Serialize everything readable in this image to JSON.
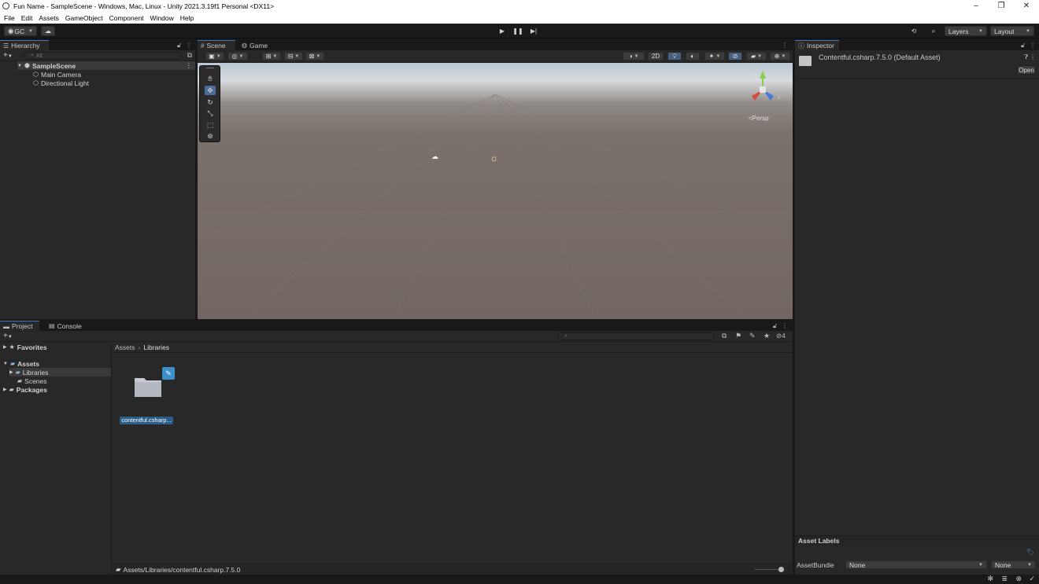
{
  "window": {
    "title": "Fun Name - SampleScene - Windows, Mac, Linux - Unity 2021.3.19f1 Personal <DX11>",
    "controls": {
      "minimize": "–",
      "maximize": "❐",
      "close": "✕"
    }
  },
  "menu": [
    "File",
    "Edit",
    "Assets",
    "GameObject",
    "Component",
    "Window",
    "Help"
  ],
  "toolbar": {
    "account_label": "GC",
    "layers_label": "Layers",
    "layout_label": "Layout"
  },
  "hierarchy": {
    "tab_label": "Hierarchy",
    "search_placeholder": "All",
    "scene_name": "SampleScene",
    "objects": [
      "Main Camera",
      "Directional Light"
    ]
  },
  "scene": {
    "tabs": [
      "Scene",
      "Game"
    ],
    "toggle_2d": "2D",
    "projection_label": "Persp",
    "gizmo_axes": {
      "y": "y",
      "z": "z"
    }
  },
  "inspector": {
    "tab_label": "Inspector",
    "asset_title": "Contentful.csharp.7.5.0 (Default Asset)",
    "open_button": "Open",
    "asset_labels_header": "Asset Labels",
    "assetbundle_label": "AssetBundle",
    "assetbundle_value": "None",
    "variant_value": "None"
  },
  "project": {
    "tabs": [
      "Project",
      "Console"
    ],
    "favorites_label": "Favorites",
    "assets_label": "Assets",
    "folders": [
      "Libraries",
      "Scenes"
    ],
    "packages_label": "Packages",
    "breadcrumb": [
      "Assets",
      "Libraries"
    ],
    "hidden_count": "4",
    "item_label": "contentful.csharp...",
    "status_path": "Assets/Libraries/contentful.csharp.7.5.0"
  },
  "colors": {
    "accent": "#3a79bb",
    "selection": "#2c5d87",
    "panel": "#282828",
    "toolbar": "#191919"
  }
}
